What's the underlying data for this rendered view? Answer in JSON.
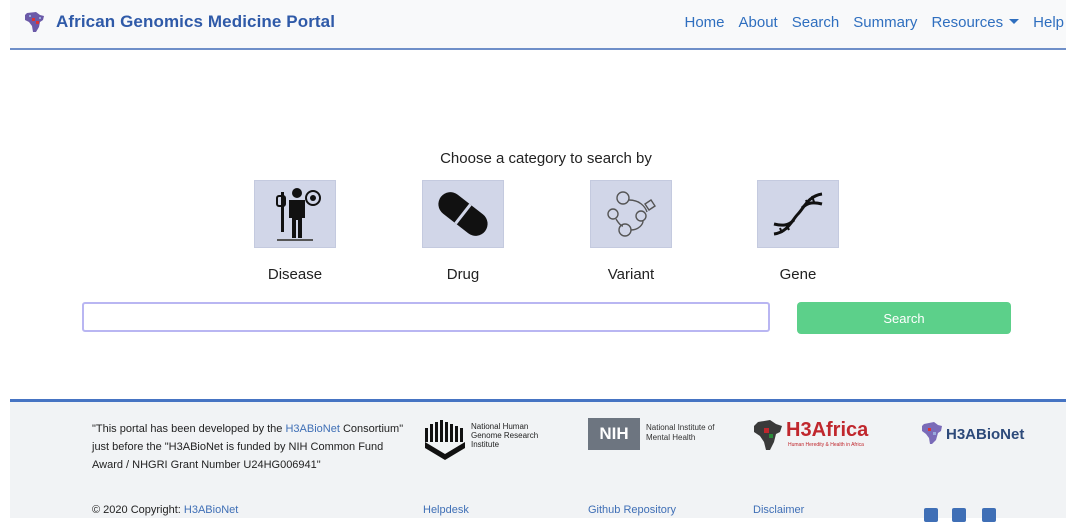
{
  "navbar": {
    "brand": "African Genomics Medicine Portal",
    "links": [
      "Home",
      "About",
      "Search",
      "Summary",
      "Resources",
      "Help"
    ]
  },
  "main": {
    "heading": "Choose a category to search by",
    "categories": [
      {
        "label": "Disease",
        "icon": "disease-person-icon"
      },
      {
        "label": "Drug",
        "icon": "capsule-icon"
      },
      {
        "label": "Variant",
        "icon": "variant-cells-icon"
      },
      {
        "label": "Gene",
        "icon": "dna-icon"
      }
    ],
    "search": {
      "value": "",
      "button_label": "Search"
    }
  },
  "footer": {
    "blurb_part1": "\"This portal has been developed by the ",
    "blurb_link": "H3ABioNet",
    "blurb_part2": " Consortium\" just before the \"H3ABioNet is funded by NIH Common Fund Award / NHGRI Grant Number U24HG006941\"",
    "copyright": "© 2020 Copyright: ",
    "copyright_link": "H3ABioNet",
    "links": [
      "Helpdesk",
      "Github Repository",
      "Disclaimer"
    ],
    "logos": {
      "nhgri": "National Human Genome Research Institute",
      "nih_box": "NIH",
      "nih_text": "National Institute of Mental Health",
      "h3africa": "H3Africa",
      "h3africa_sub": "Human Heredity & Health in Africa",
      "h3abionet": "H3ABioNet"
    },
    "social": [
      "facebook-icon",
      "twitter-icon",
      "youtube-icon"
    ]
  },
  "colors": {
    "brand": "#2f5aa8",
    "nav_link": "#2f6fbf",
    "search_button": "#5cd08a",
    "category_tile": "#d1d6e8",
    "footer_border": "#4674c3"
  }
}
